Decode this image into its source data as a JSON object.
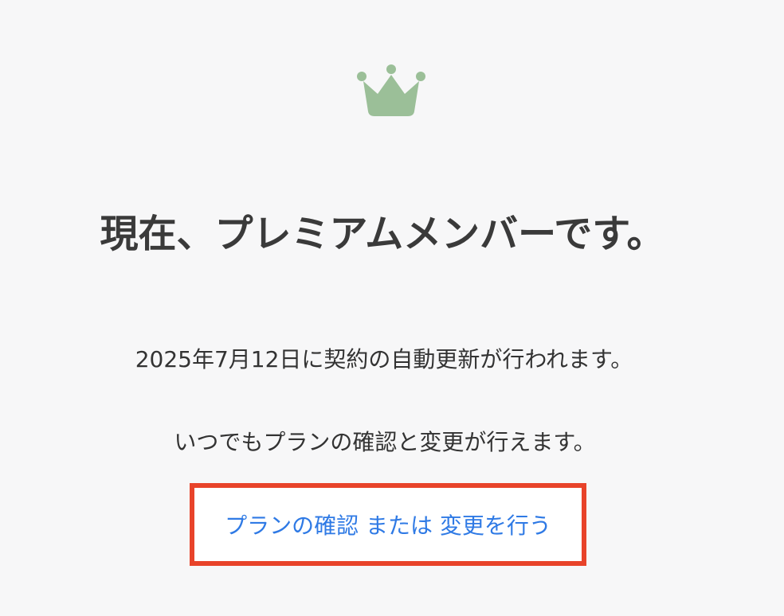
{
  "icon": {
    "name": "crown-icon",
    "color": "#9bbf98"
  },
  "heading": "現在、プレミアムメンバーです。",
  "renewal_text": "2025年7月12日に契約の自動更新が行われます。",
  "note_text": "いつでもプランの確認と変更が行えます。",
  "plan_link": {
    "label": "プランの確認 または 変更を行う",
    "color": "#2f7ae5"
  },
  "highlight_color": "#e8432a"
}
